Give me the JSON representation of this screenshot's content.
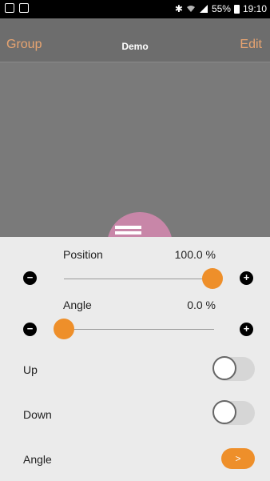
{
  "status": {
    "battery": "55%",
    "time": "19:10",
    "icons": [
      "image-icon",
      "clipboard-icon",
      "bluetooth-icon",
      "wifi-icon",
      "signal-icon",
      "battery-icon"
    ]
  },
  "nav": {
    "left": "Group",
    "title": "Demo",
    "right": "Edit"
  },
  "colors": {
    "accent": "#ee8f2a",
    "nav_link": "#e8a470",
    "device": "#c886a8"
  },
  "controls": {
    "position": {
      "label": "Position",
      "value_text": "100.0 %",
      "value": 100.0
    },
    "angle": {
      "label": "Angle",
      "value_text": "0.0 %",
      "value": 0.0
    },
    "minus_symbol": "−",
    "plus_symbol": "+"
  },
  "toggles": {
    "up": {
      "label": "Up",
      "on": false
    },
    "down": {
      "label": "Down",
      "on": false
    }
  },
  "angle_row": {
    "label": "Angle",
    "button_label": ">"
  }
}
